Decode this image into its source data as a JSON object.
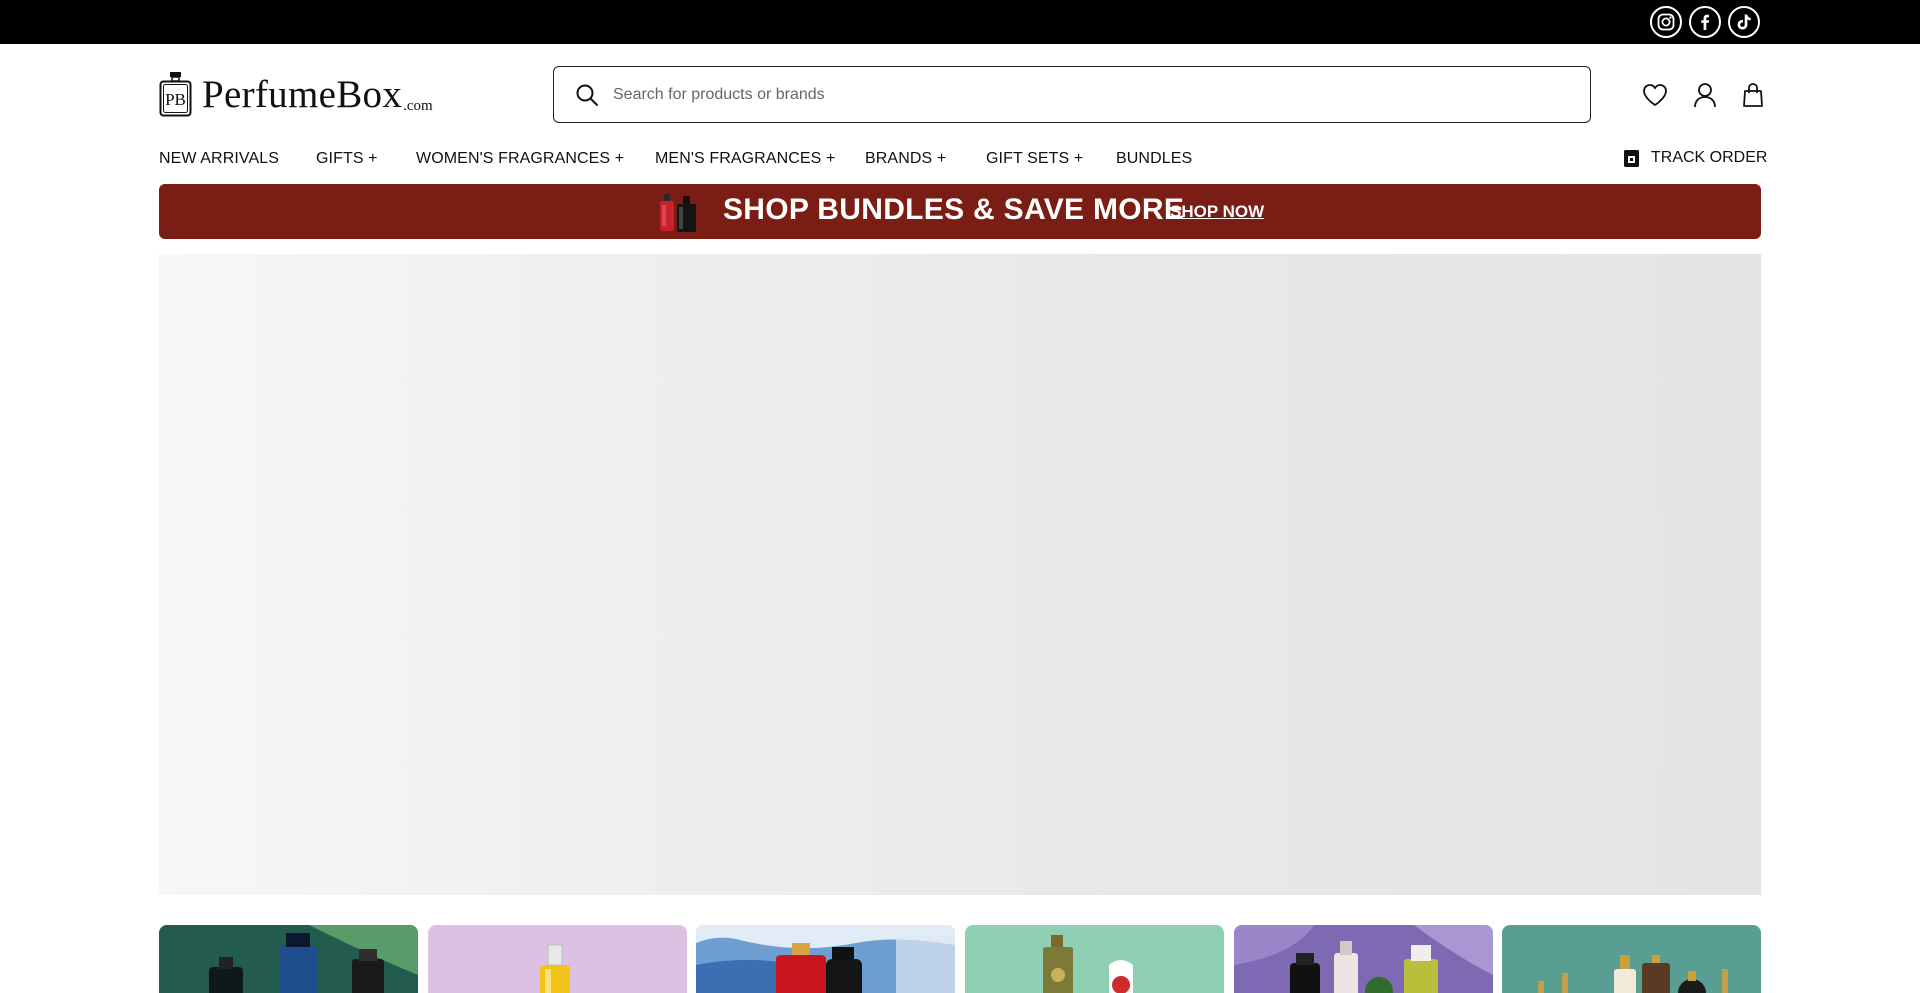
{
  "social": [
    {
      "name": "instagram-icon"
    },
    {
      "name": "facebook-icon"
    },
    {
      "name": "tiktok-icon"
    }
  ],
  "logo": {
    "mark": "PB",
    "text": "PerfumeBox",
    "suffix": ".com"
  },
  "search": {
    "placeholder": "Search for products or brands",
    "value": ""
  },
  "header_icons": [
    "heart-icon",
    "user-icon",
    "shopping-bag-icon"
  ],
  "nav": {
    "items": [
      {
        "label": "NEW ARRIVALS"
      },
      {
        "label": "GIFTS +"
      },
      {
        "label": "WOMEN'S FRAGRANCES +"
      },
      {
        "label": "MEN'S FRAGRANCES +"
      },
      {
        "label": "BRANDS +"
      },
      {
        "label": "GIFT SETS +"
      },
      {
        "label": "BUNDLES"
      }
    ],
    "track_order": "TRACK ORDER"
  },
  "promo": {
    "text": "SHOP BUNDLES & SAVE MORE",
    "link": "SHOP NOW",
    "color": "#7a1d14"
  },
  "category_tiles": [
    {
      "theme": "dark-tropical"
    },
    {
      "theme": "lilac"
    },
    {
      "theme": "waterfall-blue"
    },
    {
      "theme": "mint"
    },
    {
      "theme": "purple"
    },
    {
      "theme": "teal"
    }
  ],
  "colors": {
    "topbar": "#000000",
    "text": "#111111",
    "promo_bg": "#7a1d14"
  }
}
